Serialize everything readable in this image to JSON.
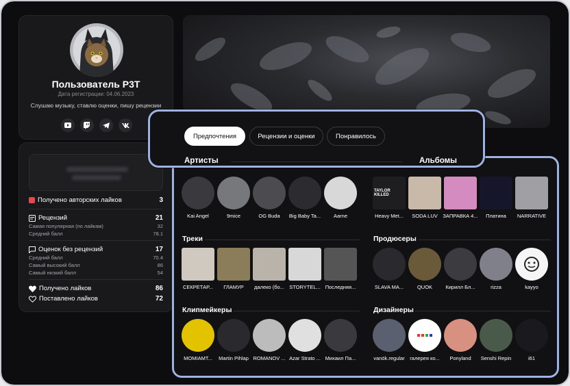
{
  "profile": {
    "username": "Пользователь P3T",
    "registration": "Дата регистрации: 04.06.2023",
    "bio": "Слушаю музыку, ставлю оценки, пишу рецензии",
    "socials": [
      "youtube-icon",
      "twitch-icon",
      "telegram-icon",
      "vk-icon"
    ]
  },
  "stats": {
    "author_likes_label": "Получено авторских лайков",
    "author_likes_value": "3",
    "reviews_label": "Рецензий",
    "reviews_value": "21",
    "reviews_popular_label": "Самая популярная (по лайкам)",
    "reviews_popular_value": "32",
    "reviews_avg_label": "Средний балл",
    "reviews_avg_value": "78.1",
    "ratings_label": "Оценок без рецензий",
    "ratings_value": "17",
    "ratings_avg_label": "Средний балл",
    "ratings_avg_value": "70.4",
    "ratings_high_label": "Самый высокий балл",
    "ratings_high_value": "86",
    "ratings_low_label": "Самый низкий балл",
    "ratings_low_value": "54",
    "likes_got_label": "Получено лайков",
    "likes_got_value": "86",
    "likes_given_label": "Поставлено лайков",
    "likes_given_value": "72"
  },
  "tabs": [
    "Предпочтения",
    "Рецензии и оценки",
    "Понравилось"
  ],
  "sections": {
    "artists": "Артисты",
    "albums": "Альбомы",
    "tracks": "Треки",
    "producers": "Продюсеры",
    "clipmakers": "Клипмейкеры",
    "designers": "Дизайнеры"
  },
  "artists": [
    "Kai Angel",
    "9mice",
    "OG Buda",
    "Big Baby Ta...",
    "Aarne"
  ],
  "albums": [
    "Heavy Met...",
    "SODA LUV",
    "ЗАПРАВКА 4...",
    "Платина",
    "NARRATIVE"
  ],
  "tracks": [
    "СЕКРЕТАР...",
    "ГЛАМУР",
    "далеко (бо...",
    "STORYTEL...",
    "Последняя..."
  ],
  "producers": [
    "SLAVA MA...",
    "QUOK",
    "Кирилл Бл...",
    "rizza",
    "kayyo"
  ],
  "clipmakers": [
    "MOMIAMT...",
    "Martin Pihlap",
    "ROMANOV ...",
    "Azar Strato ...",
    "Михаил Па..."
  ],
  "designers": [
    "vanök.regular",
    "галерея ко...",
    "Ponyland",
    "Senshi Repin",
    "i61"
  ],
  "album_art_text": "TAYLOR KILLED",
  "colors": {
    "accent": "#9fb3e3",
    "bg": "#0d0d0f",
    "card": "#19191b",
    "heart": "#e5484d"
  }
}
